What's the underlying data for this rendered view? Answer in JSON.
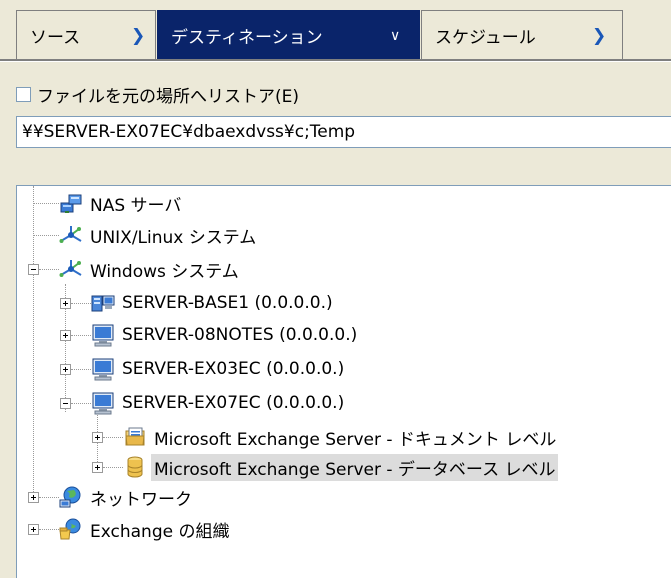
{
  "tabs": [
    {
      "label": "ソース",
      "chevron": "chevron-right-icon",
      "active": false
    },
    {
      "label": "デスティネーション",
      "chevron": "chevron-down-icon",
      "active": true
    },
    {
      "label": "スケジュール",
      "chevron": "chevron-right-icon",
      "active": false
    }
  ],
  "restore": {
    "checkbox_label": "ファイルを元の場所へリストア(E)",
    "checked": false
  },
  "path": {
    "value": "¥¥SERVER-EX07EC¥dbaexdvss¥c;Temp"
  },
  "tree": {
    "nodes": [
      {
        "label": "NAS サーバ",
        "icon": "nas-server-icon"
      },
      {
        "label": "UNIX/Linux システム",
        "icon": "network-system-icon"
      },
      {
        "label": "Windows システム",
        "icon": "network-system-icon",
        "expanded": true
      },
      {
        "label": "SERVER-BASE1 (0.0.0.0.)",
        "icon": "server-icon"
      },
      {
        "label": "SERVER-08NOTES (0.0.0.0.)",
        "icon": "computer-icon"
      },
      {
        "label": "SERVER-EX03EC (0.0.0.0.)",
        "icon": "computer-icon"
      },
      {
        "label": "SERVER-EX07EC (0.0.0.0.)",
        "icon": "computer-icon",
        "expanded": true
      },
      {
        "label": "Microsoft Exchange Server - ドキュメント レベル",
        "icon": "exchange-document-icon"
      },
      {
        "label": "Microsoft Exchange Server - データベース レベル",
        "icon": "database-icon",
        "selected": true
      },
      {
        "label": "ネットワーク",
        "icon": "network-globe-icon"
      },
      {
        "label": "Exchange の組織",
        "icon": "exchange-org-icon"
      }
    ]
  }
}
